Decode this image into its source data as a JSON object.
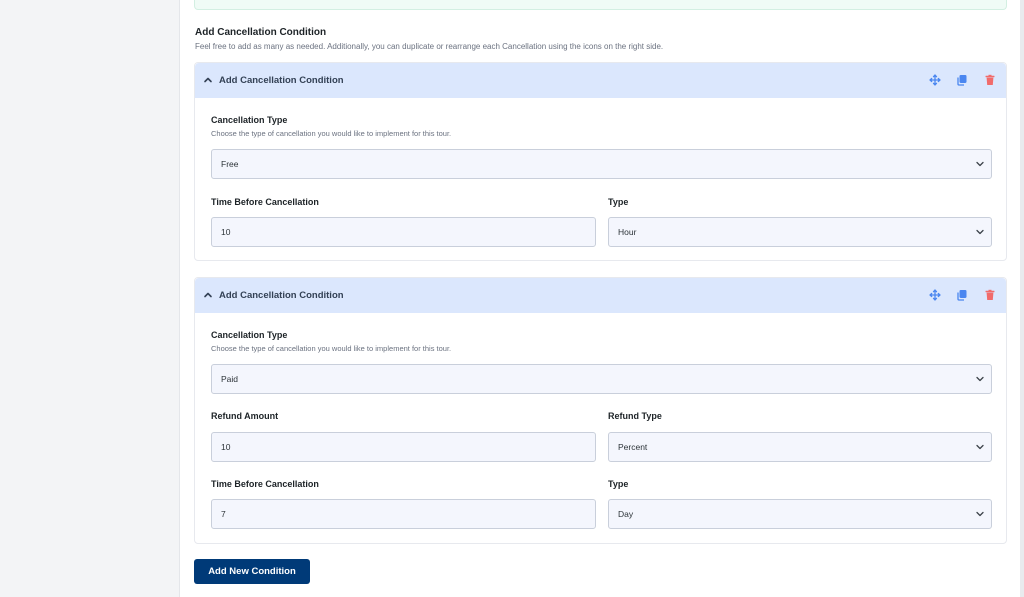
{
  "section": {
    "title": "Add Cancellation Condition",
    "description": "Feel free to add as many as needed. Additionally, you can duplicate or rearrange each Cancellation using the icons on the right side."
  },
  "conditions": [
    {
      "header": "Add Cancellation Condition",
      "cancellation_type_label": "Cancellation Type",
      "cancellation_type_help": "Choose the type of cancellation you would like to implement for this tour.",
      "cancellation_type_value": "Free",
      "time_label": "Time Before Cancellation",
      "time_value": "10",
      "type_label": "Type",
      "type_value": "Hour"
    },
    {
      "header": "Add Cancellation Condition",
      "cancellation_type_label": "Cancellation Type",
      "cancellation_type_help": "Choose the type of cancellation you would like to implement for this tour.",
      "cancellation_type_value": "Paid",
      "refund_amount_label": "Refund Amount",
      "refund_amount_value": "10",
      "refund_type_label": "Refund Type",
      "refund_type_value": "Percent",
      "time_label": "Time Before Cancellation",
      "time_value": "7",
      "type_label": "Type",
      "type_value": "Day"
    }
  ],
  "add_button": "Add New Condition",
  "icons": {
    "collapse": "chevron-up-icon",
    "move": "move-arrows-icon",
    "duplicate": "copy-icon",
    "delete": "trash-icon"
  },
  "colors": {
    "header_bg": "#dbe7fd",
    "accent_blue": "#4a86f0",
    "delete_red": "#f16b6b",
    "button_bg": "#003a78"
  }
}
